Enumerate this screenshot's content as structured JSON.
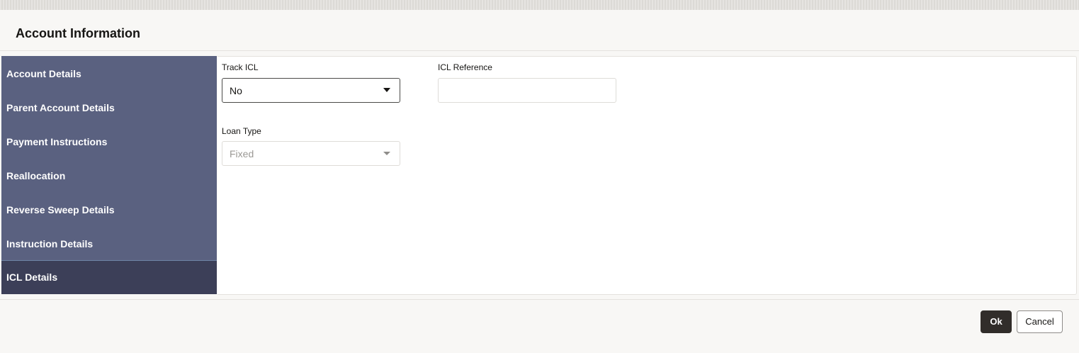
{
  "dialog": {
    "title": "Account Information"
  },
  "sidebar": {
    "items": [
      {
        "label": "Account Details"
      },
      {
        "label": "Parent Account Details"
      },
      {
        "label": "Payment Instructions"
      },
      {
        "label": "Reallocation"
      },
      {
        "label": "Reverse Sweep Details"
      },
      {
        "label": "Instruction Details"
      },
      {
        "label": "ICL Details",
        "active": true
      }
    ]
  },
  "form": {
    "track_icl": {
      "label": "Track ICL",
      "value": "No",
      "icon": "chevron-down-icon"
    },
    "icl_reference": {
      "label": "ICL Reference",
      "value": ""
    },
    "loan_type": {
      "label": "Loan Type",
      "value": "Fixed",
      "disabled": true,
      "icon": "chevron-down-icon"
    }
  },
  "footer": {
    "ok_label": "Ok",
    "cancel_label": "Cancel"
  },
  "colors": {
    "sidebar_bg": "#5a6180",
    "sidebar_active_bg": "#3c3f58",
    "primary_button": "#312d2a"
  }
}
